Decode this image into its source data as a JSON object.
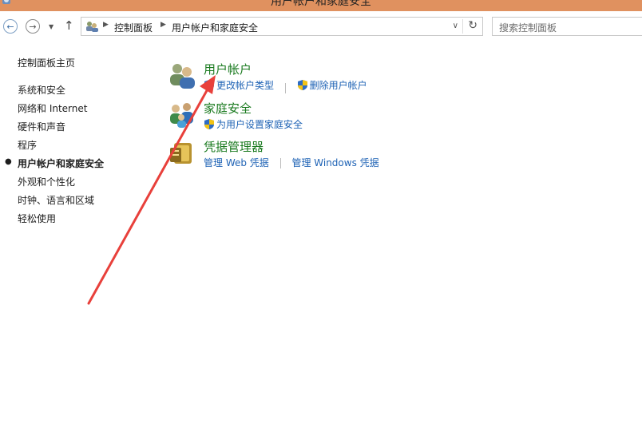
{
  "window": {
    "title": "用户帐户和家庭安全",
    "titlebar_color": "#e0915f"
  },
  "navbar": {
    "back_icon": "back-arrow-icon",
    "forward_icon": "forward-arrow-icon",
    "up_icon": "up-arrow-icon",
    "breadcrumbs": [
      "控制面板",
      "用户帐户和家庭安全"
    ],
    "search_placeholder": "搜索控制面板"
  },
  "sidebar": {
    "home": "控制面板主页",
    "items": [
      {
        "label": "系统和安全",
        "active": false
      },
      {
        "label": "网络和 Internet",
        "active": false
      },
      {
        "label": "硬件和声音",
        "active": false
      },
      {
        "label": "程序",
        "active": false
      },
      {
        "label": "用户帐户和家庭安全",
        "active": true
      },
      {
        "label": "外观和个性化",
        "active": false
      },
      {
        "label": "时钟、语言和区域",
        "active": false
      },
      {
        "label": "轻松使用",
        "active": false
      }
    ]
  },
  "categories": [
    {
      "title": "用户帐户",
      "icon": "user-accounts-icon",
      "links": [
        {
          "label": "更改帐户类型",
          "shield": true
        },
        {
          "label": "删除用户帐户",
          "shield": true
        }
      ]
    },
    {
      "title": "家庭安全",
      "icon": "family-safety-icon",
      "links": [
        {
          "label": "为用户设置家庭安全",
          "shield": true
        }
      ]
    },
    {
      "title": "凭据管理器",
      "icon": "credential-manager-icon",
      "links": [
        {
          "label": "管理 Web 凭据",
          "shield": false
        },
        {
          "label": "管理 Windows 凭据",
          "shield": false
        }
      ]
    }
  ],
  "colors": {
    "link": "#1f63b5",
    "category_title": "#1a7a1f",
    "annotation_arrow": "#e8403b"
  }
}
